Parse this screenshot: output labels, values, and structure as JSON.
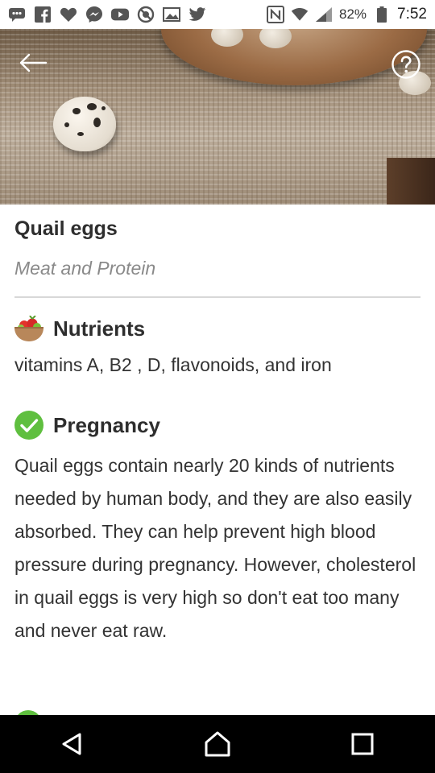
{
  "status_bar": {
    "battery": "82%",
    "time": "7:52"
  },
  "food": {
    "name": "Quail eggs",
    "category": "Meat and Protein"
  },
  "nutrients": {
    "title": "Nutrients",
    "text": "vitamins A, B2 , D, flavonoids, and iron",
    "icon": "food-bowl-icon"
  },
  "pregnancy": {
    "title": "Pregnancy",
    "text": "Quail eggs contain nearly 20 kinds of nutrients needed by human body, and they are also easily absorbed. They can help prevent high blood pressure during pregnancy. However, cholesterol in quail eggs is very high so don't eat too many and never eat raw.",
    "status": "safe",
    "icon": "check-circle-icon",
    "color": "#5fbf3f"
  },
  "nav": {
    "back": "back-triangle-icon",
    "home": "home-icon",
    "recents": "recents-square-icon"
  }
}
